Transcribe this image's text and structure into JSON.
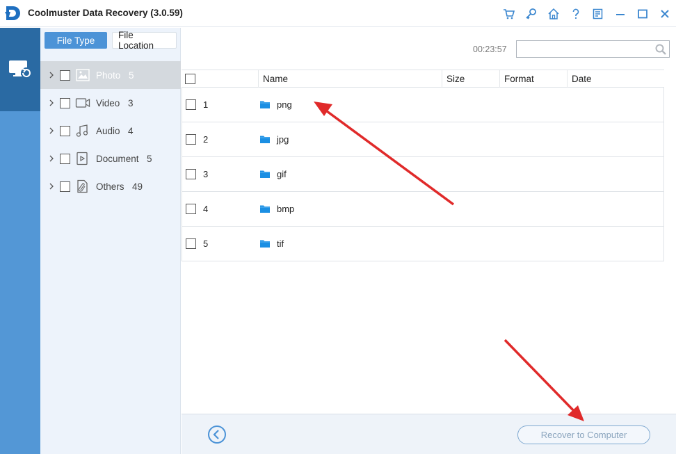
{
  "app": {
    "title": "Coolmuster Data Recovery (3.0.59)"
  },
  "titlebar": {
    "icons": [
      "cart-icon",
      "key-icon",
      "home-icon",
      "help-icon",
      "feedback-icon",
      "minimize-icon",
      "maximize-icon",
      "close-icon"
    ]
  },
  "colors": {
    "accent": "#4c93d7",
    "rail": "#5397d6",
    "rail_active": "#2a6aa3",
    "panel_bg": "#edf3fb",
    "arrow": "#e02a2a"
  },
  "tabs": {
    "file_type": "File Type",
    "file_location": "File Location"
  },
  "categories": [
    {
      "label": "Photo",
      "count": "5",
      "icon": "photo-icon",
      "selected": true
    },
    {
      "label": "Video",
      "count": "3",
      "icon": "video-icon",
      "selected": false
    },
    {
      "label": "Audio",
      "count": "4",
      "icon": "audio-icon",
      "selected": false
    },
    {
      "label": "Document",
      "count": "5",
      "icon": "document-icon",
      "selected": false
    },
    {
      "label": "Others",
      "count": "49",
      "icon": "others-icon",
      "selected": false
    }
  ],
  "timer": "00:23:57",
  "search": {
    "value": ""
  },
  "table": {
    "columns": [
      "Name",
      "Size",
      "Format",
      "Date"
    ],
    "rows": [
      {
        "num": "1",
        "name": "png"
      },
      {
        "num": "2",
        "name": "jpg"
      },
      {
        "num": "3",
        "name": "gif"
      },
      {
        "num": "4",
        "name": "bmp"
      },
      {
        "num": "5",
        "name": "tif"
      }
    ]
  },
  "footer": {
    "recover_label": "Recover to Computer"
  }
}
